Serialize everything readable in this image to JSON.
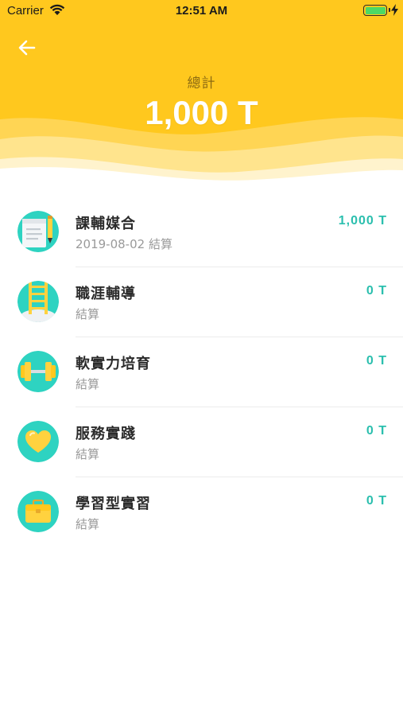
{
  "status_bar": {
    "carrier": "Carrier",
    "time": "12:51 AM",
    "battery_level": 1.0
  },
  "header": {
    "total_label": "總計",
    "total_value": "1,000 T",
    "background_color": "#ffc81e"
  },
  "items": [
    {
      "title": "課輔媒合",
      "subtitle": "2019-08-02 結算",
      "amount": "1,000  T",
      "icon": "notebook-pencil-icon"
    },
    {
      "title": "職涯輔導",
      "subtitle": "結算",
      "amount": "0 T",
      "icon": "ladder-icon"
    },
    {
      "title": "軟實力培育",
      "subtitle": "結算",
      "amount": "0 T",
      "icon": "dumbbell-icon"
    },
    {
      "title": "服務實踐",
      "subtitle": "結算",
      "amount": "0 T",
      "icon": "heart-icon"
    },
    {
      "title": "學習型實習",
      "subtitle": "結算",
      "amount": "0 T",
      "icon": "briefcase-icon"
    }
  ],
  "colors": {
    "accent": "#2bbfae",
    "icon_bg": "#2ed3c1",
    "icon_yellow": "#ffd23f"
  }
}
